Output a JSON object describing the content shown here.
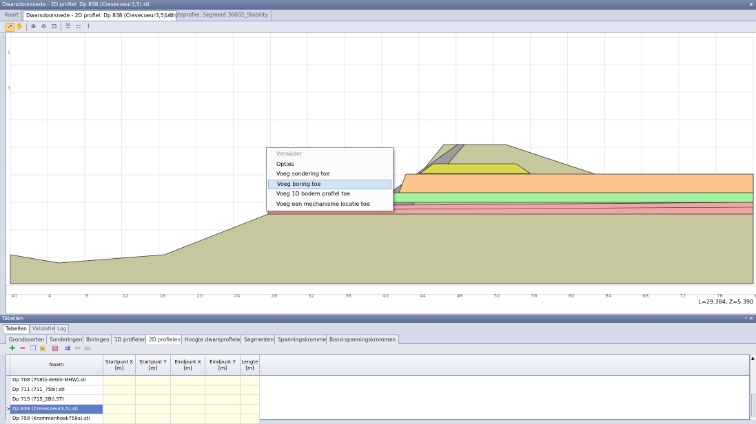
{
  "window": {
    "title": "Dwarsdoorsnede - 2D profiel: Dp 838 (Crevecoeur3,5).sti",
    "close_glyph": "×"
  },
  "doc_tabs": [
    "Kaart",
    "Dwarsdoorsnede - 2D profiel: Dp 838 (Crevecoeur3,5).sti",
    "Lengteprofiel: Segment 36002_Stability"
  ],
  "doc_tab_active": 1,
  "toolbar": {
    "icons": [
      "select-arrow-icon",
      "pan-hand-icon",
      "zoom-in-icon",
      "zoom-out-icon",
      "zoom-extent-icon",
      "list-icon",
      "layers-icon",
      "profile-icon"
    ]
  },
  "plot": {
    "x_ticks": [
      "40",
      "4",
      "8",
      "12",
      "16",
      "20",
      "24",
      "28",
      "32",
      "36",
      "40",
      "44",
      "48",
      "52",
      "56",
      "60",
      "64",
      "68",
      "72",
      "76",
      "8"
    ],
    "y_ticks": [
      "1",
      "3"
    ],
    "coordinate_readout": "L=29.384, Z=5.390",
    "colors": {
      "base": "#c6c79d",
      "orange": "#fcc58e",
      "green": "#a3f29f",
      "red": "#f0a4a4",
      "yellow": "#d9d94b",
      "gray": "#9c9c9c"
    }
  },
  "context_menu": {
    "items": [
      {
        "label": "Verwijder",
        "disabled": true
      },
      {
        "label": "Opties",
        "disabled": false
      },
      {
        "label": "Voeg sondering toe",
        "disabled": false
      },
      {
        "label": "Voeg boring toe",
        "disabled": false,
        "highlighted": true
      },
      {
        "label": "Voeg 1D bodem profiel toe",
        "disabled": false
      },
      {
        "label": "Voeg een mechanisme locatie toe",
        "disabled": false
      }
    ]
  },
  "panel": {
    "title": "Tabellen",
    "pin_glyph": "ᵖ ×"
  },
  "panel_tabs": [
    "Tabellen",
    "Validatie",
    "Log"
  ],
  "table_tabs": [
    "Grondsoorten",
    "Sonderingen",
    "Boringen",
    "1D profielen",
    "2D profielen",
    "Hoogte dwarsprofielen",
    "Segmenten",
    "Spanningskrommen",
    "Bond-spanningskrommen"
  ],
  "table_tab_active": 4,
  "table_toolbar": [
    "add-icon",
    "remove-icon",
    "copy-icon",
    "paste-icon",
    "save-icon",
    "import-icon",
    "delete-icon",
    "export-icon"
  ],
  "table": {
    "columns": [
      "Naam",
      "Startpunt X\n[m]",
      "Startpunt Y\n[m]",
      "Eindpunt X\n[m]",
      "Eindpunt Y\n[m]",
      "Lengte\n[m]"
    ],
    "rows": [
      {
        "name": "Dp 708 (708bi-deWit-MHW).sti",
        "selected": false
      },
      {
        "name": "Dp 711 (711_75bi).sti",
        "selected": false
      },
      {
        "name": "Dp 715 (715_2BI).STI",
        "selected": false
      },
      {
        "name": "Dp 838 (Crevecoeur3,5).sti",
        "selected": true
      },
      {
        "name": "Dp 758 (Krommenhoek758a).sti",
        "selected": false
      }
    ],
    "row_marker": ">"
  }
}
